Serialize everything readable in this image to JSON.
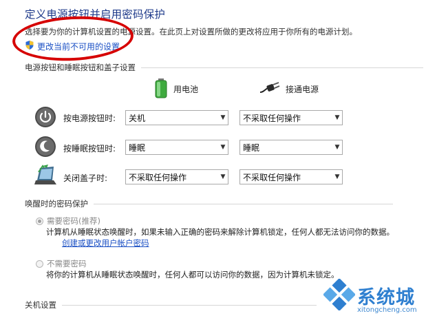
{
  "page": {
    "title": "定义电源按钮并启用密码保护",
    "description": "选择要为你的计算机设置的电源设置。在此页上对设置所做的更改将应用于你所有的电源计划。",
    "change_link": "更改当前不可用的设置"
  },
  "power_section": {
    "heading": "电源按钮和睡眠按钮和盖子设置",
    "col_battery": "用电池",
    "col_plugged": "接通电源",
    "rows": [
      {
        "label": "按电源按钮时:",
        "battery": "关机",
        "plugged": "不采取任何操作"
      },
      {
        "label": "按睡眠按钮时:",
        "battery": "睡眠",
        "plugged": "睡眠"
      },
      {
        "label": "关闭盖子时:",
        "battery": "不采取任何操作",
        "plugged": "不采取任何操作"
      }
    ]
  },
  "password_section": {
    "heading": "唤醒时的密码保护",
    "opt1_label": "需要密码(推荐)",
    "opt1_desc": "计算机从睡眠状态唤醒时，如果未输入正确的密码来解除计算机锁定，任何人都无法访问你的数据。",
    "opt1_link": "创建或更改用户帐户密码",
    "opt2_label": "不需要密码",
    "opt2_desc": "将你的计算机从睡眠状态唤醒时，任何人都可以访问你的数据，因为计算机未锁定。"
  },
  "shutdown_section": {
    "heading": "关机设置"
  },
  "watermark": {
    "name": "系统城",
    "url": "xitongcheng.com"
  },
  "colors": {
    "title": "#1e3a8a",
    "link": "#1a4fc4",
    "annotation_circle": "#d60000",
    "watermark": "#2e7fd0"
  }
}
